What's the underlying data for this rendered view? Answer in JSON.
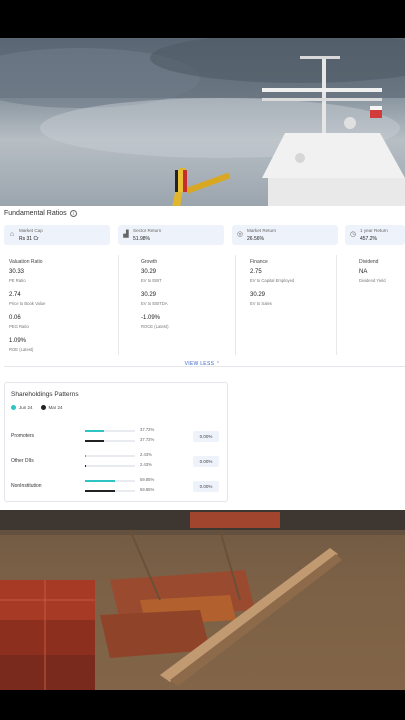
{
  "colors": {
    "jun": "#2ec4c4",
    "mar": "#222222",
    "link": "#3a66c8",
    "card_bg": "#eef2fa"
  },
  "fundamentals": {
    "title": "Fundamental Ratios",
    "info_icon": "info-icon",
    "stats": [
      {
        "icon": "building-icon",
        "label": "Market Cap",
        "value": "Rs 31 Cr"
      },
      {
        "icon": "chart-icon",
        "label": "Sector Return",
        "value": "51.98%"
      },
      {
        "icon": "target-icon",
        "label": "Market Return",
        "value": "26.56%"
      },
      {
        "icon": "clock-icon",
        "label": "1 year Return",
        "value": "457.2%"
      }
    ],
    "columns": [
      {
        "heading": "Valuation Ratio",
        "items": [
          {
            "value": "30.33",
            "label": "PE Ratio"
          },
          {
            "value": "2.74",
            "label": "Price to Book Value"
          },
          {
            "value": "0.06",
            "label": "PEG Ratio"
          },
          {
            "value": "1.09%",
            "label": "ROE (Latest)"
          }
        ]
      },
      {
        "heading": "Growth",
        "items": [
          {
            "value": "30.29",
            "label": "EV to EBIT"
          },
          {
            "value": "30.29",
            "label": "EV to EBITDA"
          },
          {
            "value": "-1.09%",
            "label": "ROCE (Latest)"
          }
        ]
      },
      {
        "heading": "Finance",
        "items": [
          {
            "value": "2.75",
            "label": "EV to Capital Employed"
          },
          {
            "value": "30.29",
            "label": "EV to Sales"
          }
        ]
      },
      {
        "heading": "Dividend",
        "items": [
          {
            "value": "NA",
            "label": "Dividend Yield"
          }
        ]
      }
    ],
    "view_less": "VIEW LESS"
  },
  "shareholdings": {
    "title": "Shareholdings Patterns",
    "legend": [
      {
        "label": "Jun 24"
      },
      {
        "label": "Mar 24"
      }
    ],
    "rows": [
      {
        "label": "Promoters",
        "jun_pct": "37.72%",
        "mar_pct": "37.72%",
        "jun_value": 37.72,
        "mar_value": 37.72,
        "delta": "0.00%"
      },
      {
        "label": "Other DIIs",
        "jun_pct": "2.43%",
        "mar_pct": "2.43%",
        "jun_value": 2.43,
        "mar_value": 2.43,
        "delta": "0.00%"
      },
      {
        "label": "NonInstitution",
        "jun_pct": "59.85%",
        "mar_pct": "59.85%",
        "jun_value": 59.85,
        "mar_value": 59.85,
        "delta": "0.00%"
      }
    ]
  }
}
